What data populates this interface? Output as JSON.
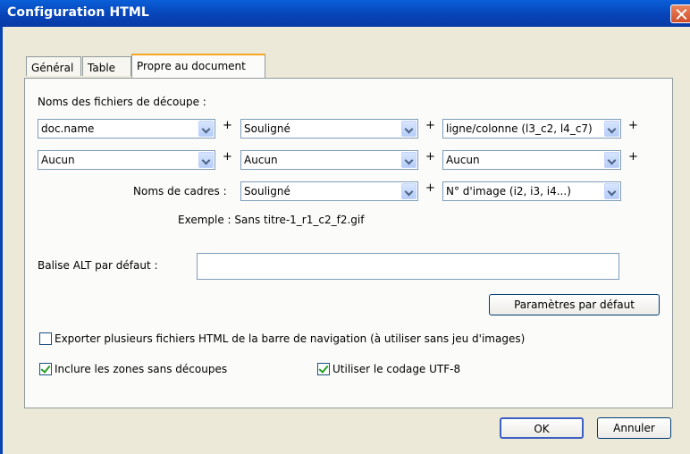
{
  "window": {
    "title": "Configuration HTML"
  },
  "tabs": [
    {
      "label": "Général"
    },
    {
      "label": "Table"
    },
    {
      "label": "Propre au document",
      "active": true
    }
  ],
  "slices": {
    "heading": "Noms des fichiers de découpe :",
    "plus": "+",
    "row1": [
      "doc.name",
      "Souligné",
      "ligne/colonne (l3_c2, l4_c7)"
    ],
    "row2": [
      "Aucun",
      "Aucun",
      "Aucun"
    ],
    "frames_label": "Noms de cadres :",
    "frames": [
      "Souligné",
      "N° d'image (i2, i3, i4...)"
    ],
    "example": "Exemple : Sans titre-1_r1_c2_f2.gif"
  },
  "alt": {
    "label": "Balise ALT par défaut :",
    "value": ""
  },
  "defaults_button": "Paramètres par défaut",
  "checkboxes": {
    "export_nav": {
      "label": "Exporter plusieurs fichiers HTML de la barre de navigation (à utiliser sans jeu d'images)",
      "checked": false
    },
    "include_zones": {
      "label": "Inclure les zones sans découpes",
      "checked": true
    },
    "utf8": {
      "label": "Utiliser le codage UTF-8",
      "checked": true
    }
  },
  "footer": {
    "ok": "OK",
    "cancel": "Annuler"
  },
  "colors": {
    "titlebar": "#0744b8",
    "active_tab_accent": "#f5a623",
    "dialog_bg": "#ece9d8",
    "check_mark": "#21a121"
  }
}
